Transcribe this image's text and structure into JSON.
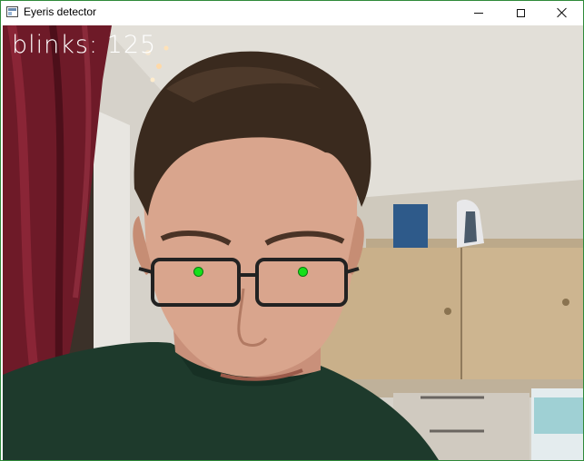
{
  "window": {
    "title": "Eyeris detector",
    "border_color": "#2f8a3a"
  },
  "overlay": {
    "label": "blinks:",
    "count": "125",
    "text_color": "#ffffff",
    "pupil_marker_color": "#16e01a"
  },
  "icons": {
    "app": "window-icon",
    "minimize": "minimize-icon",
    "maximize": "maximize-icon",
    "close": "close-icon"
  }
}
